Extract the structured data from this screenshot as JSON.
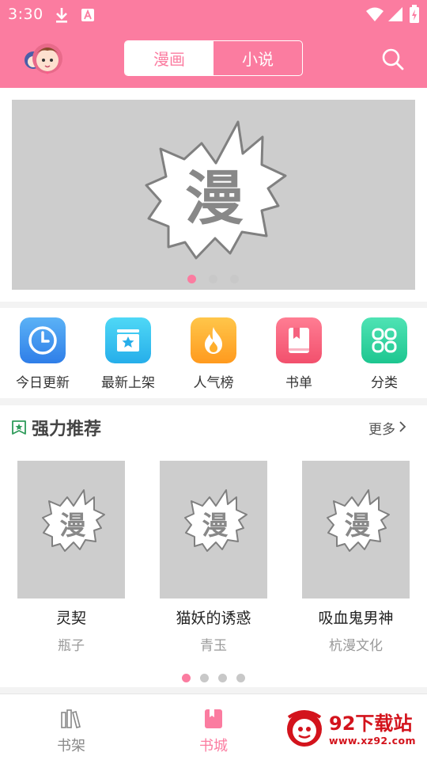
{
  "status_bar": {
    "time": "3:30"
  },
  "header": {
    "tabs": [
      {
        "label": "漫画",
        "active": true
      },
      {
        "label": "小说",
        "active": false
      }
    ]
  },
  "banner": {
    "placeholder_glyph": "漫",
    "dots": {
      "count": 3,
      "active_index": 0
    }
  },
  "quick_nav": [
    {
      "label": "今日更新",
      "icon": "clock-icon",
      "color": "#3d9bf0"
    },
    {
      "label": "最新上架",
      "icon": "star-box-icon",
      "color": "#32c5f0"
    },
    {
      "label": "人气榜",
      "icon": "flame-icon",
      "color": "#ffae2b"
    },
    {
      "label": "书单",
      "icon": "book-list-icon",
      "color": "#f5627f"
    },
    {
      "label": "分类",
      "icon": "category-grid-icon",
      "color": "#2fd6a0"
    }
  ],
  "recommend": {
    "title": "强力推荐",
    "more_label": "更多",
    "items": [
      {
        "title": "灵契",
        "author": "瓶子",
        "glyph": "漫"
      },
      {
        "title": "猫妖的诱惑",
        "author": "青玉",
        "glyph": "漫"
      },
      {
        "title": "吸血鬼男神",
        "author": "杭漫文化",
        "glyph": "漫"
      }
    ],
    "dots": {
      "count": 4,
      "active_index": 0
    }
  },
  "bottom_nav": [
    {
      "label": "书架",
      "icon": "bookshelf-icon",
      "active": false
    },
    {
      "label": "书城",
      "icon": "bookstore-icon",
      "active": true
    }
  ],
  "watermark": {
    "name": "92下载站",
    "url": "www.xz92.com"
  },
  "colors": {
    "accent": "#fb7ca0",
    "placeholder": "#cdcdcd",
    "dot_inactive": "#c8c8c8",
    "recommend_icon": "#2e9b5a"
  }
}
